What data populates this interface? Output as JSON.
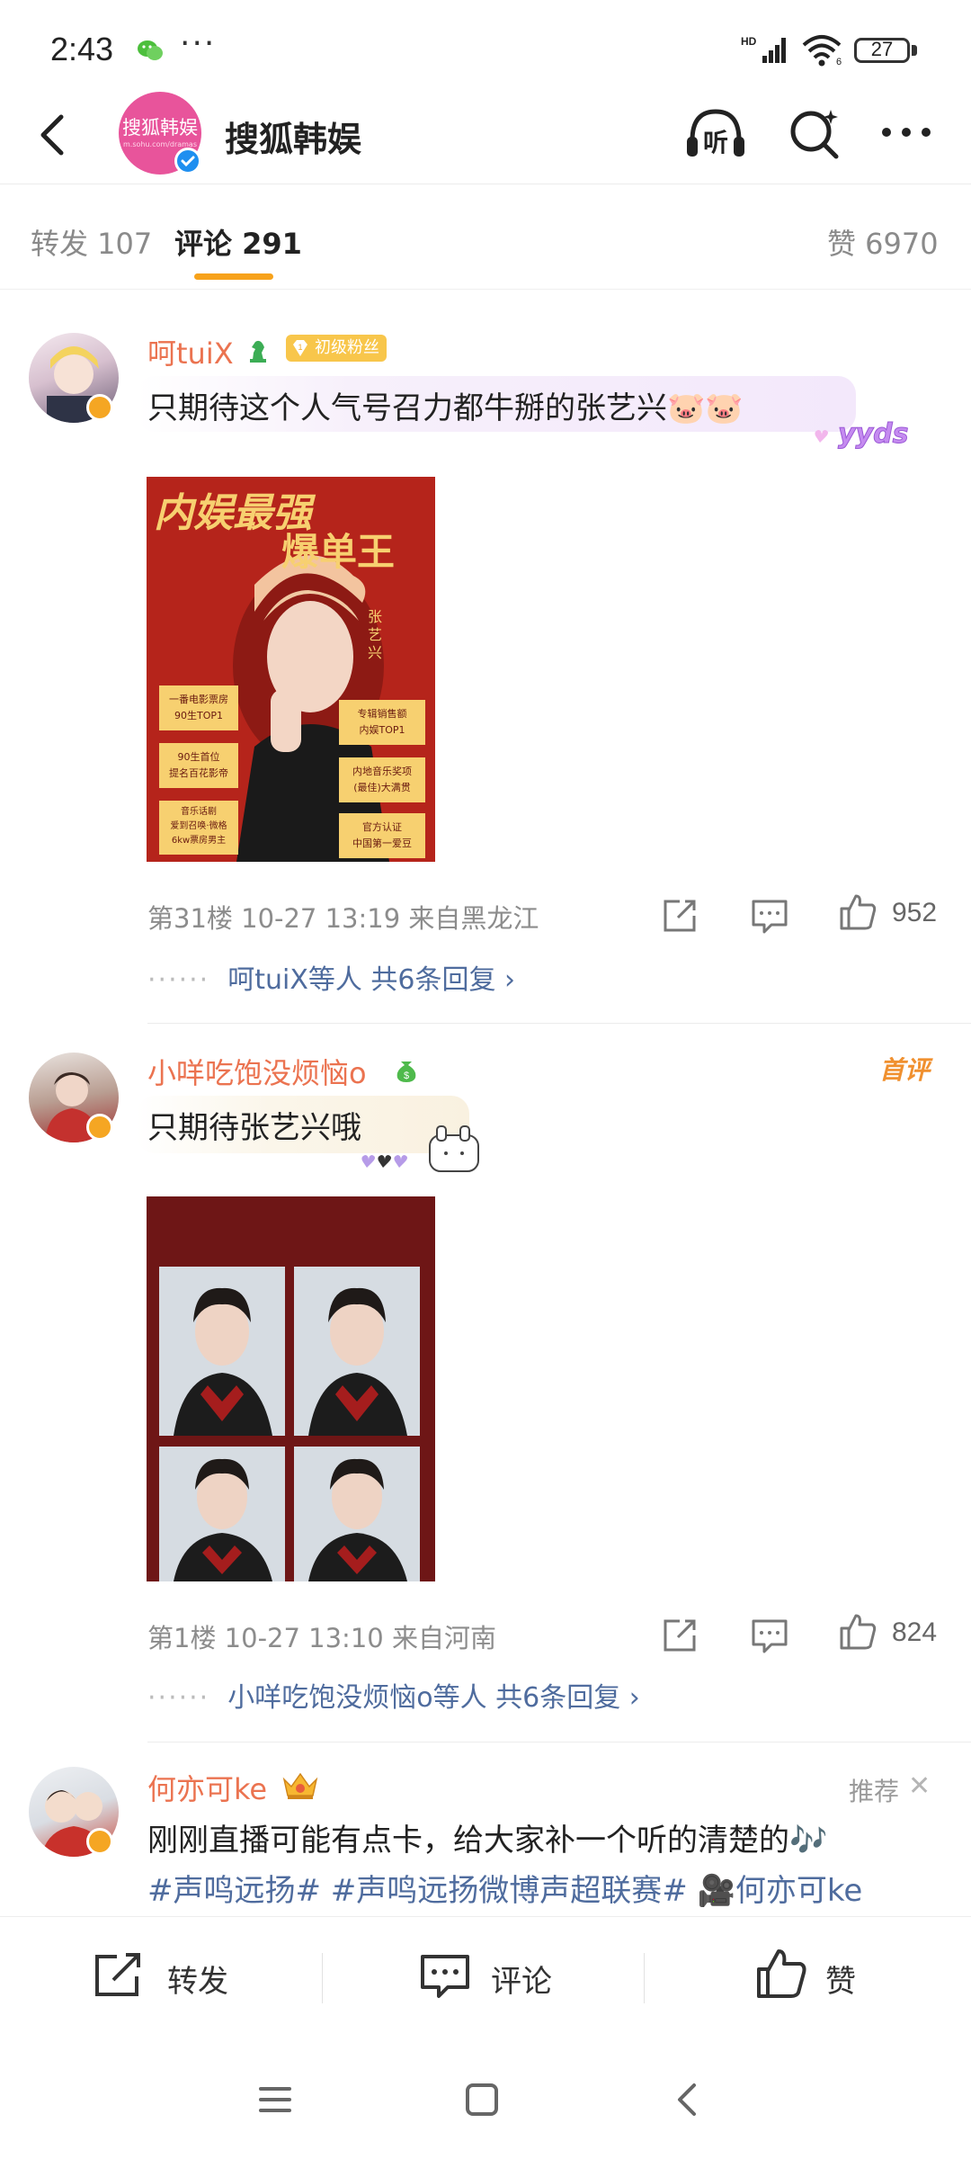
{
  "status_bar": {
    "time": "2:43",
    "battery": "27",
    "network_label": "HD"
  },
  "header": {
    "account_name": "搜狐韩娱",
    "avatar_logo_text": "搜狐韩娱",
    "avatar_logo_sub": "m.sohu.com/dramas"
  },
  "tabs": {
    "repost": "转发 107",
    "comments": "评论 291",
    "likes": "赞 6970"
  },
  "comments": [
    {
      "username": "呵tuiX",
      "fan_badge": "初级粉丝",
      "text": "只期待这个人气号召力都牛掰的张艺兴🐷🐷",
      "bubble_sticker": "yyds",
      "image": {
        "headline_1": "内娱最强",
        "headline_2": "爆单王",
        "name": "张艺兴",
        "boxes_left": [
          "一番电影票房\n90生TOP1",
          "90生首位\n提名百花影帝",
          "音乐话剧\n爱到召唤·微格\n6kw票房男主"
        ],
        "boxes_right": [
          "专辑销售额\n内娱TOP1",
          "内地音乐奖项\n(最佳)大满贯",
          "官方认证\n中国第一爱豆"
        ]
      },
      "meta": "第31楼  10-27 13:19  来自黑龙江",
      "likes": "952",
      "replies_text": "呵tuiX等人  共6条回复 ›"
    },
    {
      "username": "小咩吃饱没烦恼o",
      "tag": "首评",
      "text": "只期待张艺兴哦",
      "meta": "第1楼  10-27 13:10  来自河南",
      "likes": "824",
      "replies_text": "小咩吃饱没烦恼o等人  共6条回复 ›"
    },
    {
      "username": "何亦可ke",
      "tag": "推荐",
      "close": "✕",
      "text": "刚刚直播可能有点卡，给大家补一个听的清楚的🎶",
      "topics": "#声鸣远扬# #声鸣远扬微博声超联赛# 🎥何亦可ke"
    }
  ],
  "action_bar": {
    "repost": "转发",
    "comment": "评论",
    "like": "赞"
  },
  "colors": {
    "username": "#eb7350",
    "link": "#4f6c9e",
    "accent": "#f7a21b",
    "verified_orange": "#f5a623",
    "verified_blue": "#1f8ff0"
  },
  "icons": [
    "back-icon",
    "listen-icon",
    "search-icon",
    "more-icon",
    "share-icon",
    "comment-icon",
    "like-icon",
    "menu-icon",
    "home-icon",
    "nav-back-icon"
  ]
}
